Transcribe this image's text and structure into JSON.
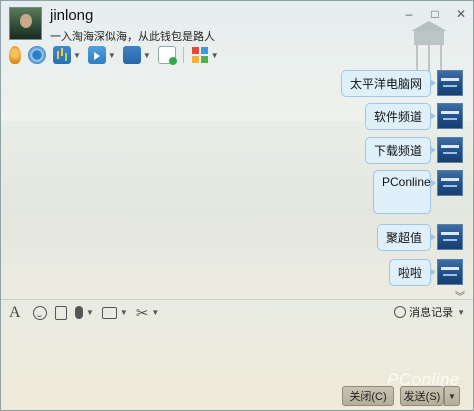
{
  "header": {
    "username": "jinlong",
    "signature": "一入淘海深似海，从此钱包是路人"
  },
  "window_controls": {
    "minimize": "–",
    "maximize": "□",
    "close": "✕"
  },
  "toolbar": {
    "icons": [
      "microphone-icon",
      "webcam-icon",
      "screen-share-icon",
      "send-file-icon",
      "remote-desktop-icon",
      "notes-icon",
      "apps-icon"
    ]
  },
  "messages": [
    {
      "text": "太平洋电脑网"
    },
    {
      "text": "软件频道"
    },
    {
      "text": "下载频道"
    },
    {
      "text": "PConline"
    },
    {
      "text": "聚超值"
    },
    {
      "text": "啦啦"
    }
  ],
  "input_toolbar": {
    "font_icon": "A",
    "history_label": "消息记录"
  },
  "footer": {
    "close_label": "关闭(C)",
    "send_label": "发送(S)",
    "watermark": "PConline"
  },
  "colors": {
    "bubble_fill": "#dff0fb",
    "bubble_border": "#9fc6e2",
    "button_fill": "#c2bea9"
  }
}
